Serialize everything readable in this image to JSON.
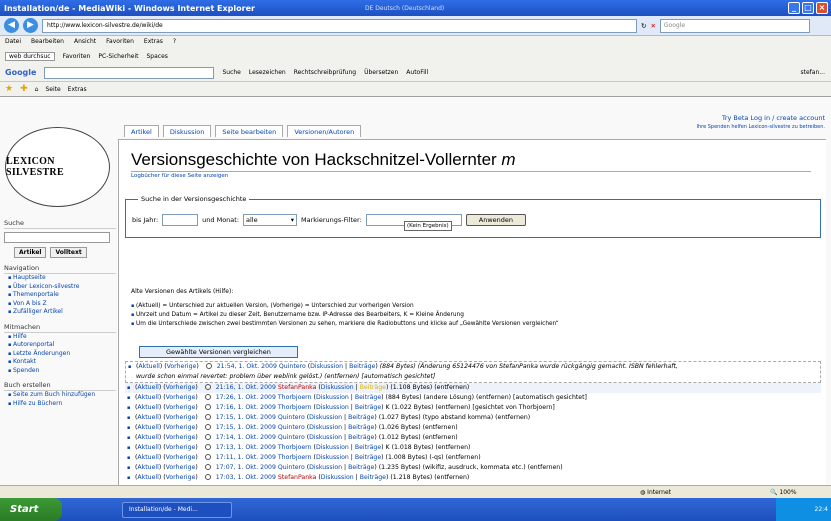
{
  "window": {
    "title": "Installation/de - MediaWiki - Windows Internet Explorer",
    "title_ext": "DE Deutsch (Deutschland)"
  },
  "browser": {
    "address": "http://www.lexicon-silvestre.de/wiki/de",
    "search_placeholder": "Google",
    "menu": [
      "Datei",
      "Bearbeiten",
      "Ansicht",
      "Favoriten",
      "Extras",
      "?"
    ],
    "links": [
      "web durchsuc",
      "Favoriten",
      "PC-Sicherheit",
      "Spaces"
    ],
    "googlebar": [
      "Google",
      "Suche",
      "Lesezeichen",
      "Rechtschreibprüfung",
      "Übersetzen",
      "AutoFill",
      "stefan..."
    ],
    "favbar": [
      "Seite",
      "Extras"
    ]
  },
  "site": {
    "logo_text": "LEXICON SILVESTRE",
    "top_links": "Try Beta  Log in / create account",
    "donate": "Ihre Spenden helfen Lexicon-silvestre zu betreiben."
  },
  "tabs": [
    "Artikel",
    "Diskussion",
    "Seite bearbeiten",
    "Versionen/Autoren"
  ],
  "sidebar": {
    "search_h": "Suche",
    "btn_article": "Artikel",
    "btn_fulltext": "Volltext",
    "nav_h": "Navigation",
    "nav": [
      "Hauptseite",
      "Über Lexicon-silvestre",
      "Themenportale",
      "Von A bis Z",
      "Zufälliger Artikel"
    ],
    "mit_h": "Mitmachen",
    "mit": [
      "Hilfe",
      "Autorenportal",
      "Letzte Änderungen",
      "Kontakt",
      "Spenden"
    ],
    "buch_h": "Buch erstellen",
    "buch": [
      "Seite zum Buch hinzufügen",
      "Hilfe zu Büchern"
    ]
  },
  "page": {
    "heading": "Versionsgeschichte von Hackschnitzel-Vollernter ",
    "heading_m": "m",
    "subtitle": "Logbücher für diese Seite anzeigen",
    "legend": "Suche in der Versionsgeschichte",
    "year_label": "bis Jahr:",
    "month_label": "und Monat:",
    "month_value": "alle",
    "tag_label": "Markierungs-Filter:",
    "go": "Anwenden",
    "autocomplete": "(Kein Ergebnis)",
    "old_label": "Alte Versionen des Artikels (Hilfe):",
    "legend_items": [
      "(Aktuell) = Unterschied zur aktuellen Version, (Vorherige) = Unterschied zur vorherigen Version",
      "Uhrzeit und Datum = Artikel zu dieser Zeit, Benutzername bzw. IP-Adresse des Bearbeiters, K = Kleine Änderung",
      "Um die Unterschiede zwischen zwei bestimmten Versionen zu sehen, markiere die Radiobuttons und klicke auf „Gewählte Versionen vergleichen“"
    ],
    "compare_btn": "Gewählte Versionen vergleichen"
  },
  "history": [
    {
      "date": "21:54, 1. Okt. 2009",
      "user": "Quintero",
      "info": "(884 Bytes) (Änderung 65124476 von StefanPanka wurde rückgängig gemacht. ISBN fehlerhaft,",
      "info2": "wurde schon einmal revertet: problem über weblink gelöst.) (entfernen) [automatisch gesichtet]"
    },
    {
      "date": "21:16, 1. Okt. 2009",
      "user": "StefanPanka",
      "info": "(1.108 Bytes) (entfernen)"
    },
    {
      "date": "17:26, 1. Okt. 2009",
      "user": "Thorbjoern",
      "info": "(884 Bytes) (andere Lösung) (entfernen) [automatisch gesichtet]"
    },
    {
      "date": "17:16, 1. Okt. 2009",
      "user": "Thorbjoern",
      "info": "K (1.022 Bytes) (entfernen) [gesichtet von Thorbjoern]"
    },
    {
      "date": "17:15, 1. Okt. 2009",
      "user": "Quintero",
      "info": "(1.027 Bytes) (typo abstand komma) (entfernen)"
    },
    {
      "date": "17:15, 1. Okt. 2009",
      "user": "Quintero",
      "info": "(1.026 Bytes) (entfernen)"
    },
    {
      "date": "17:14, 1. Okt. 2009",
      "user": "Quintero",
      "info": "(1.012 Bytes) (entfernen)"
    },
    {
      "date": "17:13, 1. Okt. 2009",
      "user": "Thorbjoern",
      "info": "K (1.018 Bytes) (entfernen)"
    },
    {
      "date": "17:11, 1. Okt. 2009",
      "user": "Thorbjoern",
      "info": "(1.008 Bytes) (-qs) (entfernen)"
    },
    {
      "date": "17:07, 1. Okt. 2009",
      "user": "Quintero",
      "info": "(1.235 Bytes) (wikifiz, ausdruck, kommata etc.) (entfernen)"
    },
    {
      "date": "17:03, 1. Okt. 2009",
      "user": "StefanPanka",
      "info": "(1.218 Bytes) (entfernen)"
    }
  ],
  "status": {
    "zone": "Internet",
    "zoom": "100%"
  },
  "taskbar": {
    "start": "Start",
    "task": "Installation/de - Medi...",
    "clock": "22:4"
  }
}
